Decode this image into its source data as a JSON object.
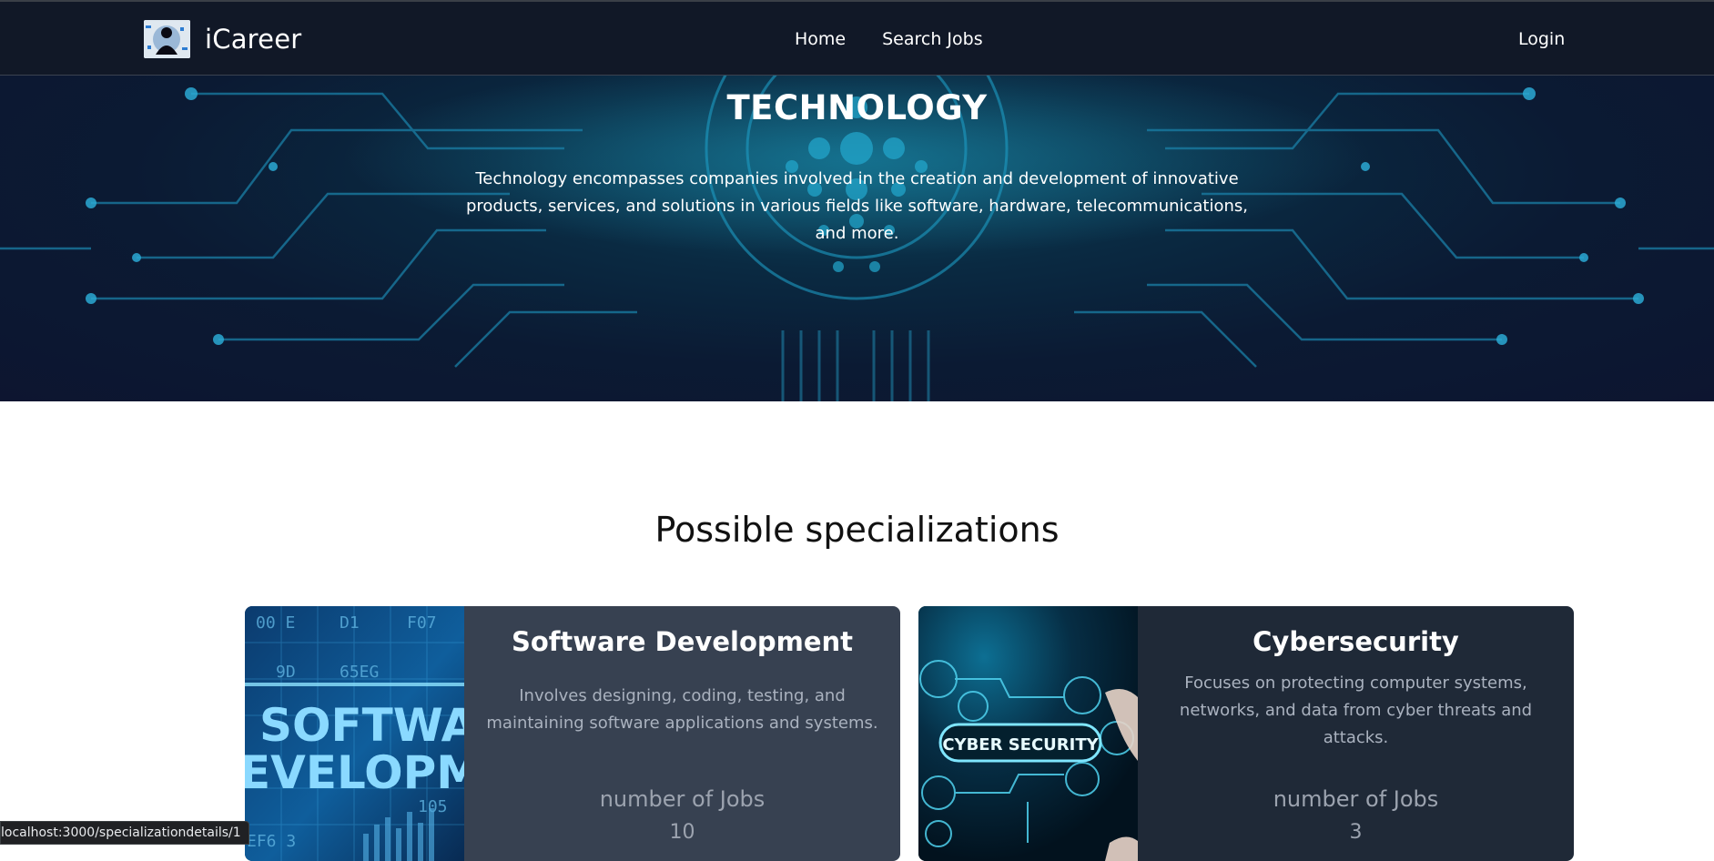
{
  "navbar": {
    "brand_name": "iCareer",
    "links": [
      "Home",
      "Search Jobs"
    ],
    "login_label": "Login"
  },
  "hero": {
    "title": "TECHNOLOGY",
    "description": "Technology encompasses companies involved in the creation and development of innovative products, services, and solutions in various fields like software, hardware, telecommunications, and more."
  },
  "specializations": {
    "heading": "Possible specializations",
    "cards": [
      {
        "title": "Software Development",
        "description": "Involves designing, coding, testing, and maintaining software applications and systems.",
        "jobs_label": "number of Jobs",
        "jobs_count": "10",
        "image_text": [
          "SOFTWAR",
          "EVELOPM"
        ],
        "image_codes": [
          "00 E",
          "D1",
          "F07",
          "9D",
          "65EG",
          "EF6 3",
          "105"
        ]
      },
      {
        "title": "Cybersecurity",
        "description": "Focuses on protecting computer systems, networks, and data from cyber threats and attacks.",
        "jobs_label": "number of Jobs",
        "jobs_count": "3",
        "image_text": [
          "CYBER SECURITY"
        ]
      }
    ]
  },
  "status_bar": {
    "url": "localhost:3000/specializationdetails/1"
  },
  "colors": {
    "navbar_bg": "#111827",
    "card_1_bg": "#374151",
    "card_2_bg": "#1f2937",
    "hero_accent": "#1fa6c9"
  }
}
